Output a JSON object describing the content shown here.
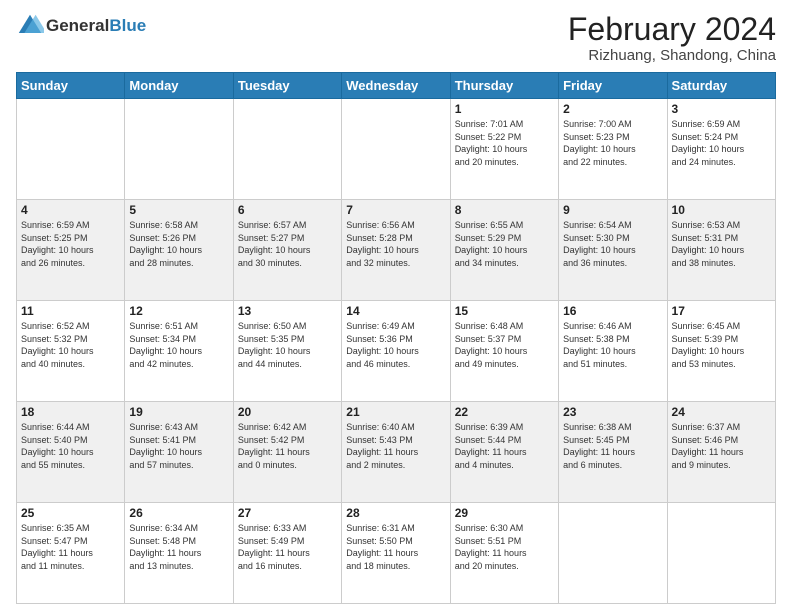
{
  "header": {
    "logo_text_general": "General",
    "logo_text_blue": "Blue",
    "month_title": "February 2024",
    "location": "Rizhuang, Shandong, China"
  },
  "days_of_week": [
    "Sunday",
    "Monday",
    "Tuesday",
    "Wednesday",
    "Thursday",
    "Friday",
    "Saturday"
  ],
  "weeks": [
    [
      {
        "day": "",
        "info": ""
      },
      {
        "day": "",
        "info": ""
      },
      {
        "day": "",
        "info": ""
      },
      {
        "day": "",
        "info": ""
      },
      {
        "day": "1",
        "info": "Sunrise: 7:01 AM\nSunset: 5:22 PM\nDaylight: 10 hours\nand 20 minutes."
      },
      {
        "day": "2",
        "info": "Sunrise: 7:00 AM\nSunset: 5:23 PM\nDaylight: 10 hours\nand 22 minutes."
      },
      {
        "day": "3",
        "info": "Sunrise: 6:59 AM\nSunset: 5:24 PM\nDaylight: 10 hours\nand 24 minutes."
      }
    ],
    [
      {
        "day": "4",
        "info": "Sunrise: 6:59 AM\nSunset: 5:25 PM\nDaylight: 10 hours\nand 26 minutes."
      },
      {
        "day": "5",
        "info": "Sunrise: 6:58 AM\nSunset: 5:26 PM\nDaylight: 10 hours\nand 28 minutes."
      },
      {
        "day": "6",
        "info": "Sunrise: 6:57 AM\nSunset: 5:27 PM\nDaylight: 10 hours\nand 30 minutes."
      },
      {
        "day": "7",
        "info": "Sunrise: 6:56 AM\nSunset: 5:28 PM\nDaylight: 10 hours\nand 32 minutes."
      },
      {
        "day": "8",
        "info": "Sunrise: 6:55 AM\nSunset: 5:29 PM\nDaylight: 10 hours\nand 34 minutes."
      },
      {
        "day": "9",
        "info": "Sunrise: 6:54 AM\nSunset: 5:30 PM\nDaylight: 10 hours\nand 36 minutes."
      },
      {
        "day": "10",
        "info": "Sunrise: 6:53 AM\nSunset: 5:31 PM\nDaylight: 10 hours\nand 38 minutes."
      }
    ],
    [
      {
        "day": "11",
        "info": "Sunrise: 6:52 AM\nSunset: 5:32 PM\nDaylight: 10 hours\nand 40 minutes."
      },
      {
        "day": "12",
        "info": "Sunrise: 6:51 AM\nSunset: 5:34 PM\nDaylight: 10 hours\nand 42 minutes."
      },
      {
        "day": "13",
        "info": "Sunrise: 6:50 AM\nSunset: 5:35 PM\nDaylight: 10 hours\nand 44 minutes."
      },
      {
        "day": "14",
        "info": "Sunrise: 6:49 AM\nSunset: 5:36 PM\nDaylight: 10 hours\nand 46 minutes."
      },
      {
        "day": "15",
        "info": "Sunrise: 6:48 AM\nSunset: 5:37 PM\nDaylight: 10 hours\nand 49 minutes."
      },
      {
        "day": "16",
        "info": "Sunrise: 6:46 AM\nSunset: 5:38 PM\nDaylight: 10 hours\nand 51 minutes."
      },
      {
        "day": "17",
        "info": "Sunrise: 6:45 AM\nSunset: 5:39 PM\nDaylight: 10 hours\nand 53 minutes."
      }
    ],
    [
      {
        "day": "18",
        "info": "Sunrise: 6:44 AM\nSunset: 5:40 PM\nDaylight: 10 hours\nand 55 minutes."
      },
      {
        "day": "19",
        "info": "Sunrise: 6:43 AM\nSunset: 5:41 PM\nDaylight: 10 hours\nand 57 minutes."
      },
      {
        "day": "20",
        "info": "Sunrise: 6:42 AM\nSunset: 5:42 PM\nDaylight: 11 hours\nand 0 minutes."
      },
      {
        "day": "21",
        "info": "Sunrise: 6:40 AM\nSunset: 5:43 PM\nDaylight: 11 hours\nand 2 minutes."
      },
      {
        "day": "22",
        "info": "Sunrise: 6:39 AM\nSunset: 5:44 PM\nDaylight: 11 hours\nand 4 minutes."
      },
      {
        "day": "23",
        "info": "Sunrise: 6:38 AM\nSunset: 5:45 PM\nDaylight: 11 hours\nand 6 minutes."
      },
      {
        "day": "24",
        "info": "Sunrise: 6:37 AM\nSunset: 5:46 PM\nDaylight: 11 hours\nand 9 minutes."
      }
    ],
    [
      {
        "day": "25",
        "info": "Sunrise: 6:35 AM\nSunset: 5:47 PM\nDaylight: 11 hours\nand 11 minutes."
      },
      {
        "day": "26",
        "info": "Sunrise: 6:34 AM\nSunset: 5:48 PM\nDaylight: 11 hours\nand 13 minutes."
      },
      {
        "day": "27",
        "info": "Sunrise: 6:33 AM\nSunset: 5:49 PM\nDaylight: 11 hours\nand 16 minutes."
      },
      {
        "day": "28",
        "info": "Sunrise: 6:31 AM\nSunset: 5:50 PM\nDaylight: 11 hours\nand 18 minutes."
      },
      {
        "day": "29",
        "info": "Sunrise: 6:30 AM\nSunset: 5:51 PM\nDaylight: 11 hours\nand 20 minutes."
      },
      {
        "day": "",
        "info": ""
      },
      {
        "day": "",
        "info": ""
      }
    ]
  ]
}
